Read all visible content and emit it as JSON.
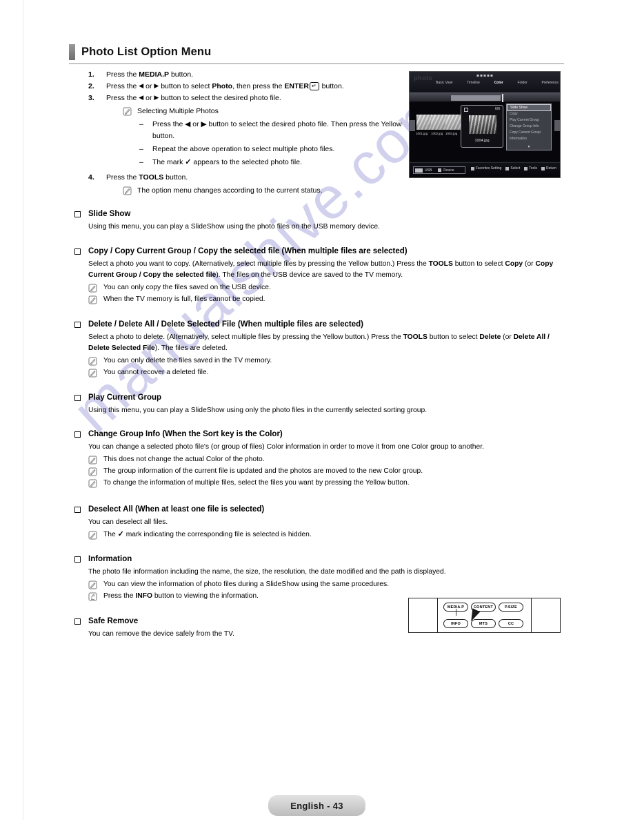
{
  "page": {
    "title": "Photo List Option Menu",
    "footer_label": "English - 43",
    "watermark": "manualshive.com"
  },
  "steps": [
    {
      "num": "1.",
      "html_key": "s1"
    },
    {
      "num": "2.",
      "html_key": "s2"
    },
    {
      "num": "3.",
      "html_key": "s3"
    },
    {
      "num": "4.",
      "html_key": "s4"
    }
  ],
  "step_text": {
    "s1_a": "Press the ",
    "s1_b": "MEDIA.P",
    "s1_c": " button.",
    "s2_a": "Press the ",
    "s2_arrow_l": "◀",
    "s2_or": " or ",
    "s2_arrow_r": "▶",
    "s2_b": " button to select ",
    "s2_bold": "Photo",
    "s2_c": ", then press the ",
    "s2_enter": "ENTER",
    "s2_d": " button.",
    "s3_a": "Press the ",
    "s3_b": " button to select the desired photo file.",
    "s3_note": "Selecting Multiple Photos",
    "s3_dash1": "Press the ◀ or ▶ button to select the desired photo file. Then press the Yellow button.",
    "s3_dash2": "Repeat the above operation to select multiple photo files.",
    "s3_dash3_a": "The mark ",
    "s3_dash3_b": " appears to the selected photo file.",
    "s4_a": "Press the ",
    "s4_b": "TOOLS",
    "s4_c": " button.",
    "s4_note": "The option menu changes according to the current status."
  },
  "tv": {
    "logo": "photo",
    "tabs": [
      "Basic View",
      "Timeline",
      "Color",
      "Folder",
      "Preference"
    ],
    "active_tab": "Color",
    "thumbs": [
      {
        "caption": "1001.jpg"
      },
      {
        "caption": "1002.jpg"
      },
      {
        "caption": "1003.jpg"
      }
    ],
    "selected": {
      "count": "6/6",
      "caption": "1004.jpg"
    },
    "menu_items": [
      "Slide Show",
      "Copy",
      "Play Current Group",
      "Change Group Info",
      "Copy Current Group",
      "Information"
    ],
    "menu_selected": "Slide Show",
    "menu_more": "▼",
    "footer_left": [
      "USB",
      "Device"
    ],
    "footer_right": [
      "Favorites Setting",
      "Select",
      "Tools",
      "Return"
    ]
  },
  "sections": [
    {
      "heading": "Slide Show",
      "body": "Using this menu, you can play a SlideShow using the photo files on the USB memory device.",
      "notes": []
    },
    {
      "heading": "Copy / Copy Current Group / Copy the selected file (When multiple files are selected)",
      "body_1a": "Select a photo you want to copy. (Alternatively, select multiple files by pressing the Yellow button.) Press the ",
      "body_1b": "TOOLS",
      "body_1c": " button to select ",
      "body_1d": "Copy",
      "body_1e": " (or ",
      "body_1f": "Copy Current Group / Copy the selected file",
      "body_1g": "). The files on the USB device are saved to the TV memory.",
      "notes": [
        "You can only copy the files saved on the USB device.",
        "When the TV memory is full, files cannot be copied."
      ]
    },
    {
      "heading": "Delete / Delete All / Delete Selected File (When multiple files are selected)",
      "body_1a": "Select a photo to delete. (Alternatively, select multiple files by pressing the Yellow button.) Press the ",
      "body_1b": "TOOLS",
      "body_1c": " button to select ",
      "body_1d": "Delete",
      "body_1e": " (or ",
      "body_1f": "Delete All / Delete Selected File",
      "body_1g": "). The files are deleted.",
      "notes": [
        "You can only delete the files saved in the TV memory.",
        "You cannot recover a deleted file."
      ]
    },
    {
      "heading": "Play Current Group",
      "body": "Using this menu, you can play a SlideShow using only the photo files in the currently selected sorting group.",
      "notes": []
    },
    {
      "heading": "Change Group Info (When the Sort key is the Color)",
      "body": "You can change a selected photo file's (or group of files) Color information in order to move it from one Color group to another.",
      "notes": [
        "This does not change the actual Color of the photo.",
        "The group information of the current file is updated and the photos are moved to the new Color group.",
        "To change the information of multiple files, select the files you want by pressing the Yellow button."
      ]
    },
    {
      "heading": "Deselect All (When at least one file is selected)",
      "body": "You can deselect all files.",
      "note_check_a": "The ",
      "note_check_b": " mark indicating the corresponding file is selected is hidden.",
      "notes": []
    },
    {
      "heading": "Information",
      "body": "The photo file information including the name, the size, the resolution, the date modified and the path is displayed.",
      "notes": [
        "You can view the information of photo files during a SlideShow using the same procedures."
      ],
      "press_note_a": "Press the ",
      "press_note_b": "INFO",
      "press_note_c": " button to viewing the information."
    },
    {
      "heading": "Safe Remove",
      "body": "You can remove the device safely from the TV.",
      "notes": []
    }
  ],
  "remote": {
    "buttons_top": [
      "MEDIA.P",
      "CONTENT",
      "P.SIZE"
    ],
    "buttons_bottom": [
      "INFO",
      "MTS",
      "CC"
    ]
  },
  "colors": {
    "watermark": "#c9c8ea",
    "header_bar": "#7a7a7a",
    "footer_pill": "#cfcfcf"
  }
}
